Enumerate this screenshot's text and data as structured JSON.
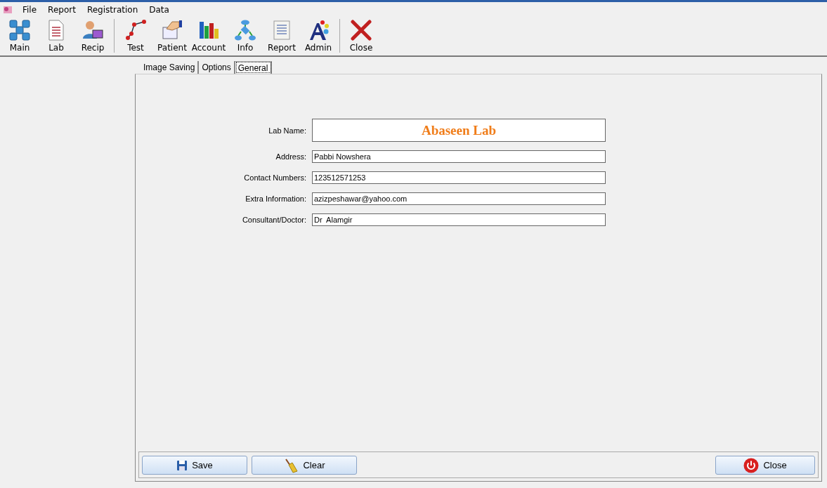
{
  "menu": [
    "File",
    "Report",
    "Registration",
    "Data"
  ],
  "toolbar": {
    "groups": [
      [
        "Main",
        "Lab",
        "Recip"
      ],
      [
        "Test",
        "Patient",
        "Account",
        "Info",
        "Report",
        "Admin"
      ],
      [
        "Close"
      ]
    ]
  },
  "tabs": [
    {
      "label": "Image Saving",
      "selected": false
    },
    {
      "label": "Options",
      "selected": false
    },
    {
      "label": "General",
      "selected": true
    }
  ],
  "form": [
    {
      "label": "Lab Name:",
      "value": "Abaseen Lab",
      "kind": "title"
    },
    {
      "label": "Address:",
      "value": "Pabbi Nowshera",
      "kind": "text"
    },
    {
      "label": "Contact Numbers:",
      "value": "123512571253",
      "kind": "text"
    },
    {
      "label": "Extra Information:",
      "value": "azizpeshawar@yahoo.com",
      "kind": "text"
    },
    {
      "label": "Consultant/Doctor:",
      "value": "Dr  Alamgir",
      "kind": "text"
    }
  ],
  "buttons": {
    "left": [
      "Save",
      "Clear"
    ],
    "right": [
      "Close"
    ]
  }
}
